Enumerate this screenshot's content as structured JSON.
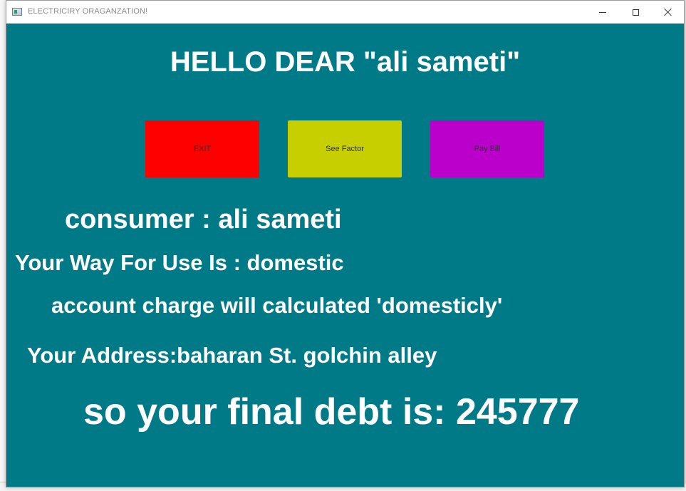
{
  "window": {
    "title": "ELECTRICIRY ORAGANZATION!",
    "icon": "java-app-icon",
    "controls": {
      "minimize": "minimize-icon",
      "maximize": "maximize-icon",
      "close": "close-icon"
    }
  },
  "main": {
    "greeting": "HELLO DEAR \"ali sameti\"",
    "buttons": {
      "exit": "EXIT",
      "see_factor": "See Factor",
      "pay_bill": "Pay Bill"
    },
    "consumer": "consumer : ali sameti",
    "usage": "Your Way For Use Is : domestic",
    "charge_note": "account charge will calculated 'domesticly'",
    "address": "Your Address:baharan St. golchin alley",
    "debt": "so your final debt is: 245777"
  },
  "colors": {
    "background": "#007a86",
    "exit_button": "#ff0000",
    "factor_button": "#c7cf00",
    "pay_button": "#bb00cc",
    "text": "#ffffff"
  }
}
